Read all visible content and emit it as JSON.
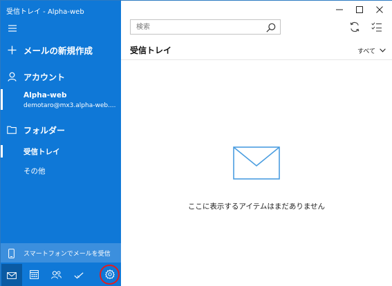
{
  "window": {
    "title": "受信トレイ - Alpha-web"
  },
  "sidebar": {
    "new_mail_label": "メールの新規作成",
    "accounts_header": "アカウント",
    "account": {
      "name": "Alpha-web",
      "email": "demotaro@mx3.alpha-web...."
    },
    "folders_header": "フォルダー",
    "folders": [
      {
        "label": "受信トレイ",
        "selected": true
      },
      {
        "label": "その他",
        "selected": false
      }
    ],
    "phone_label": "スマートフォンでメールを受信",
    "bottom_nav": [
      "mail-icon",
      "calendar-icon",
      "people-icon",
      "todo-icon",
      "settings-icon"
    ]
  },
  "main": {
    "search_placeholder": "検索",
    "folder_title": "受信トレイ",
    "filter_label": "すべて",
    "empty_message": "ここに表示するアイテムはまだありません"
  },
  "colors": {
    "sidebar_bg": "#0f78d7",
    "selected_nav_bg": "#0a5aa3",
    "phone_row_bg": "#3c8fdd",
    "highlight_ring": "#e21d1d",
    "envelope_stroke": "#4a9de0"
  }
}
